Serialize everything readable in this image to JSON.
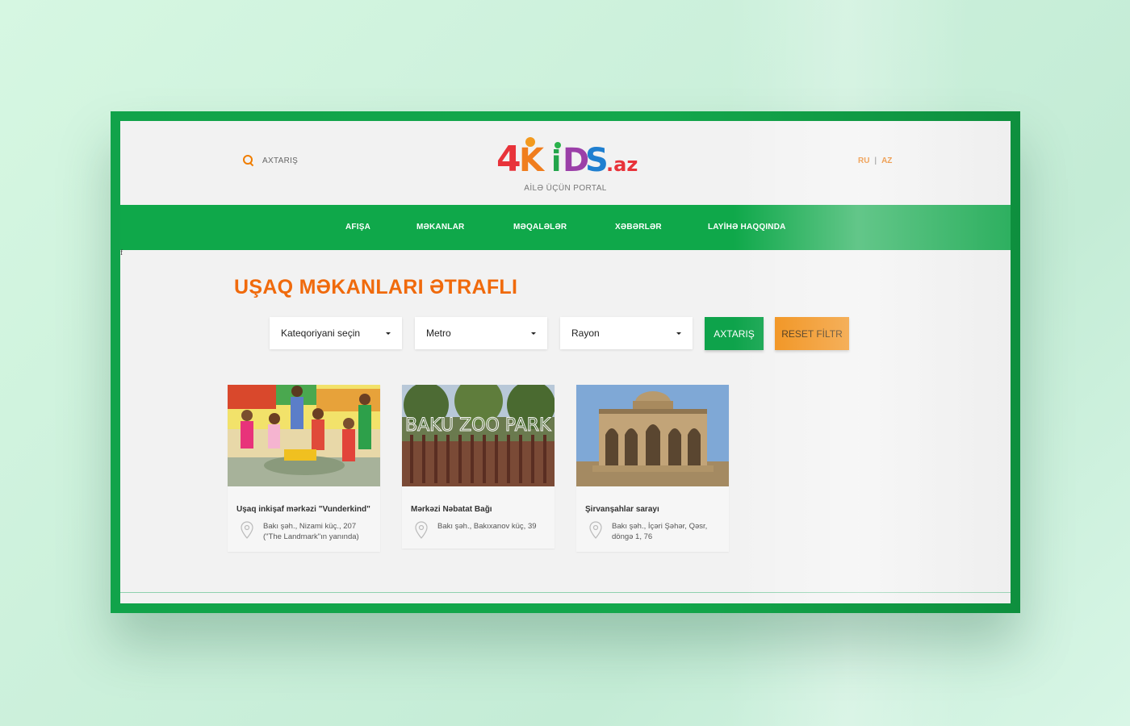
{
  "header": {
    "search_label": "AXTARIŞ",
    "logo_text": "4KiDS.az",
    "tagline": "AİLƏ ÜÇÜN PORTAL",
    "lang_ru": "RU",
    "lang_sep": "|",
    "lang_az": "AZ"
  },
  "nav": {
    "items": [
      {
        "label": "AFIŞA"
      },
      {
        "label": "MƏKANLAR"
      },
      {
        "label": "MƏQALƏLƏR"
      },
      {
        "label": "XƏBƏRLƏR"
      },
      {
        "label": "LAYİHƏ HAQQINDA"
      }
    ]
  },
  "stray_text": "f",
  "page": {
    "title": "UŞAQ MƏKANLARI ƏTRAFLI"
  },
  "filters": {
    "category": "Kateqoriyani seçin",
    "metro": "Metro",
    "rayon": "Rayon",
    "search_button": "AXTARIŞ",
    "reset_button": "RESET FİLTR"
  },
  "places": [
    {
      "title": "Uşaq inkişaf mərkəzi \"Vunderkind\"",
      "address": "Bakı şəh., Nizami küç., 207 (\"The Landmark\"ın yanında)"
    },
    {
      "title": "Mərkəzi Nəbatat Bağı",
      "address": "Bakı şəh., Bakıxanov küç, 39"
    },
    {
      "title": "Şirvanşahlar sarayı",
      "address": "Bakı şəh., İçəri Şəhər, Qəsr, döngə 1, 76"
    }
  ],
  "zoo_sign": "BAKU ZOO PARK",
  "colors": {
    "brand_green": "#0fa84a",
    "accent_orange": "#f06a0c",
    "reset_orange": "#f08a0c"
  }
}
